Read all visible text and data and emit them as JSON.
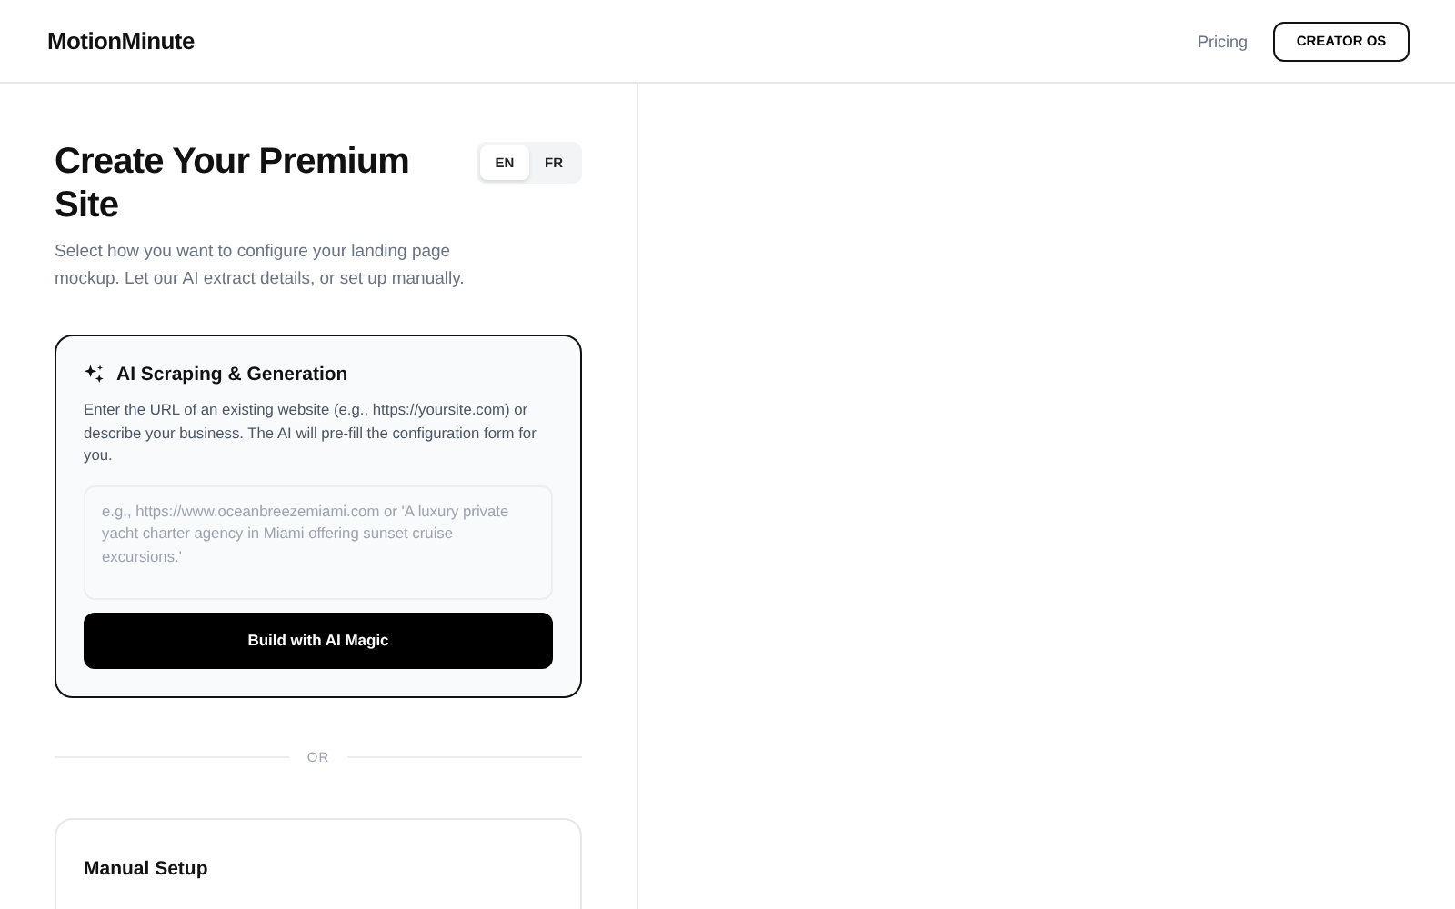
{
  "header": {
    "logo": "MotionMinute",
    "nav_link": "Pricing",
    "cta": "CREATOR OS"
  },
  "intro": {
    "title": "Create Your Premium Site",
    "description": "Select how you want to configure your landing page mockup. Let our AI extract details, or set up manually."
  },
  "languages": [
    {
      "label": "EN",
      "selected": true
    },
    {
      "label": "FR",
      "selected": false
    }
  ],
  "ai_card": {
    "title": "AI Scraping & Generation",
    "description": "Enter the URL of an existing website (e.g., https://yoursite.com) or describe your business. The AI will pre-fill the configuration form for you.",
    "placeholder": "e.g., https://www.oceanbreezemiami.com or 'A luxury private yacht charter agency in Miami offering sunset cruise excursions.'",
    "button": "Build with AI Magic"
  },
  "divider": "OR",
  "manual_card": {
    "title": "Manual Setup"
  }
}
